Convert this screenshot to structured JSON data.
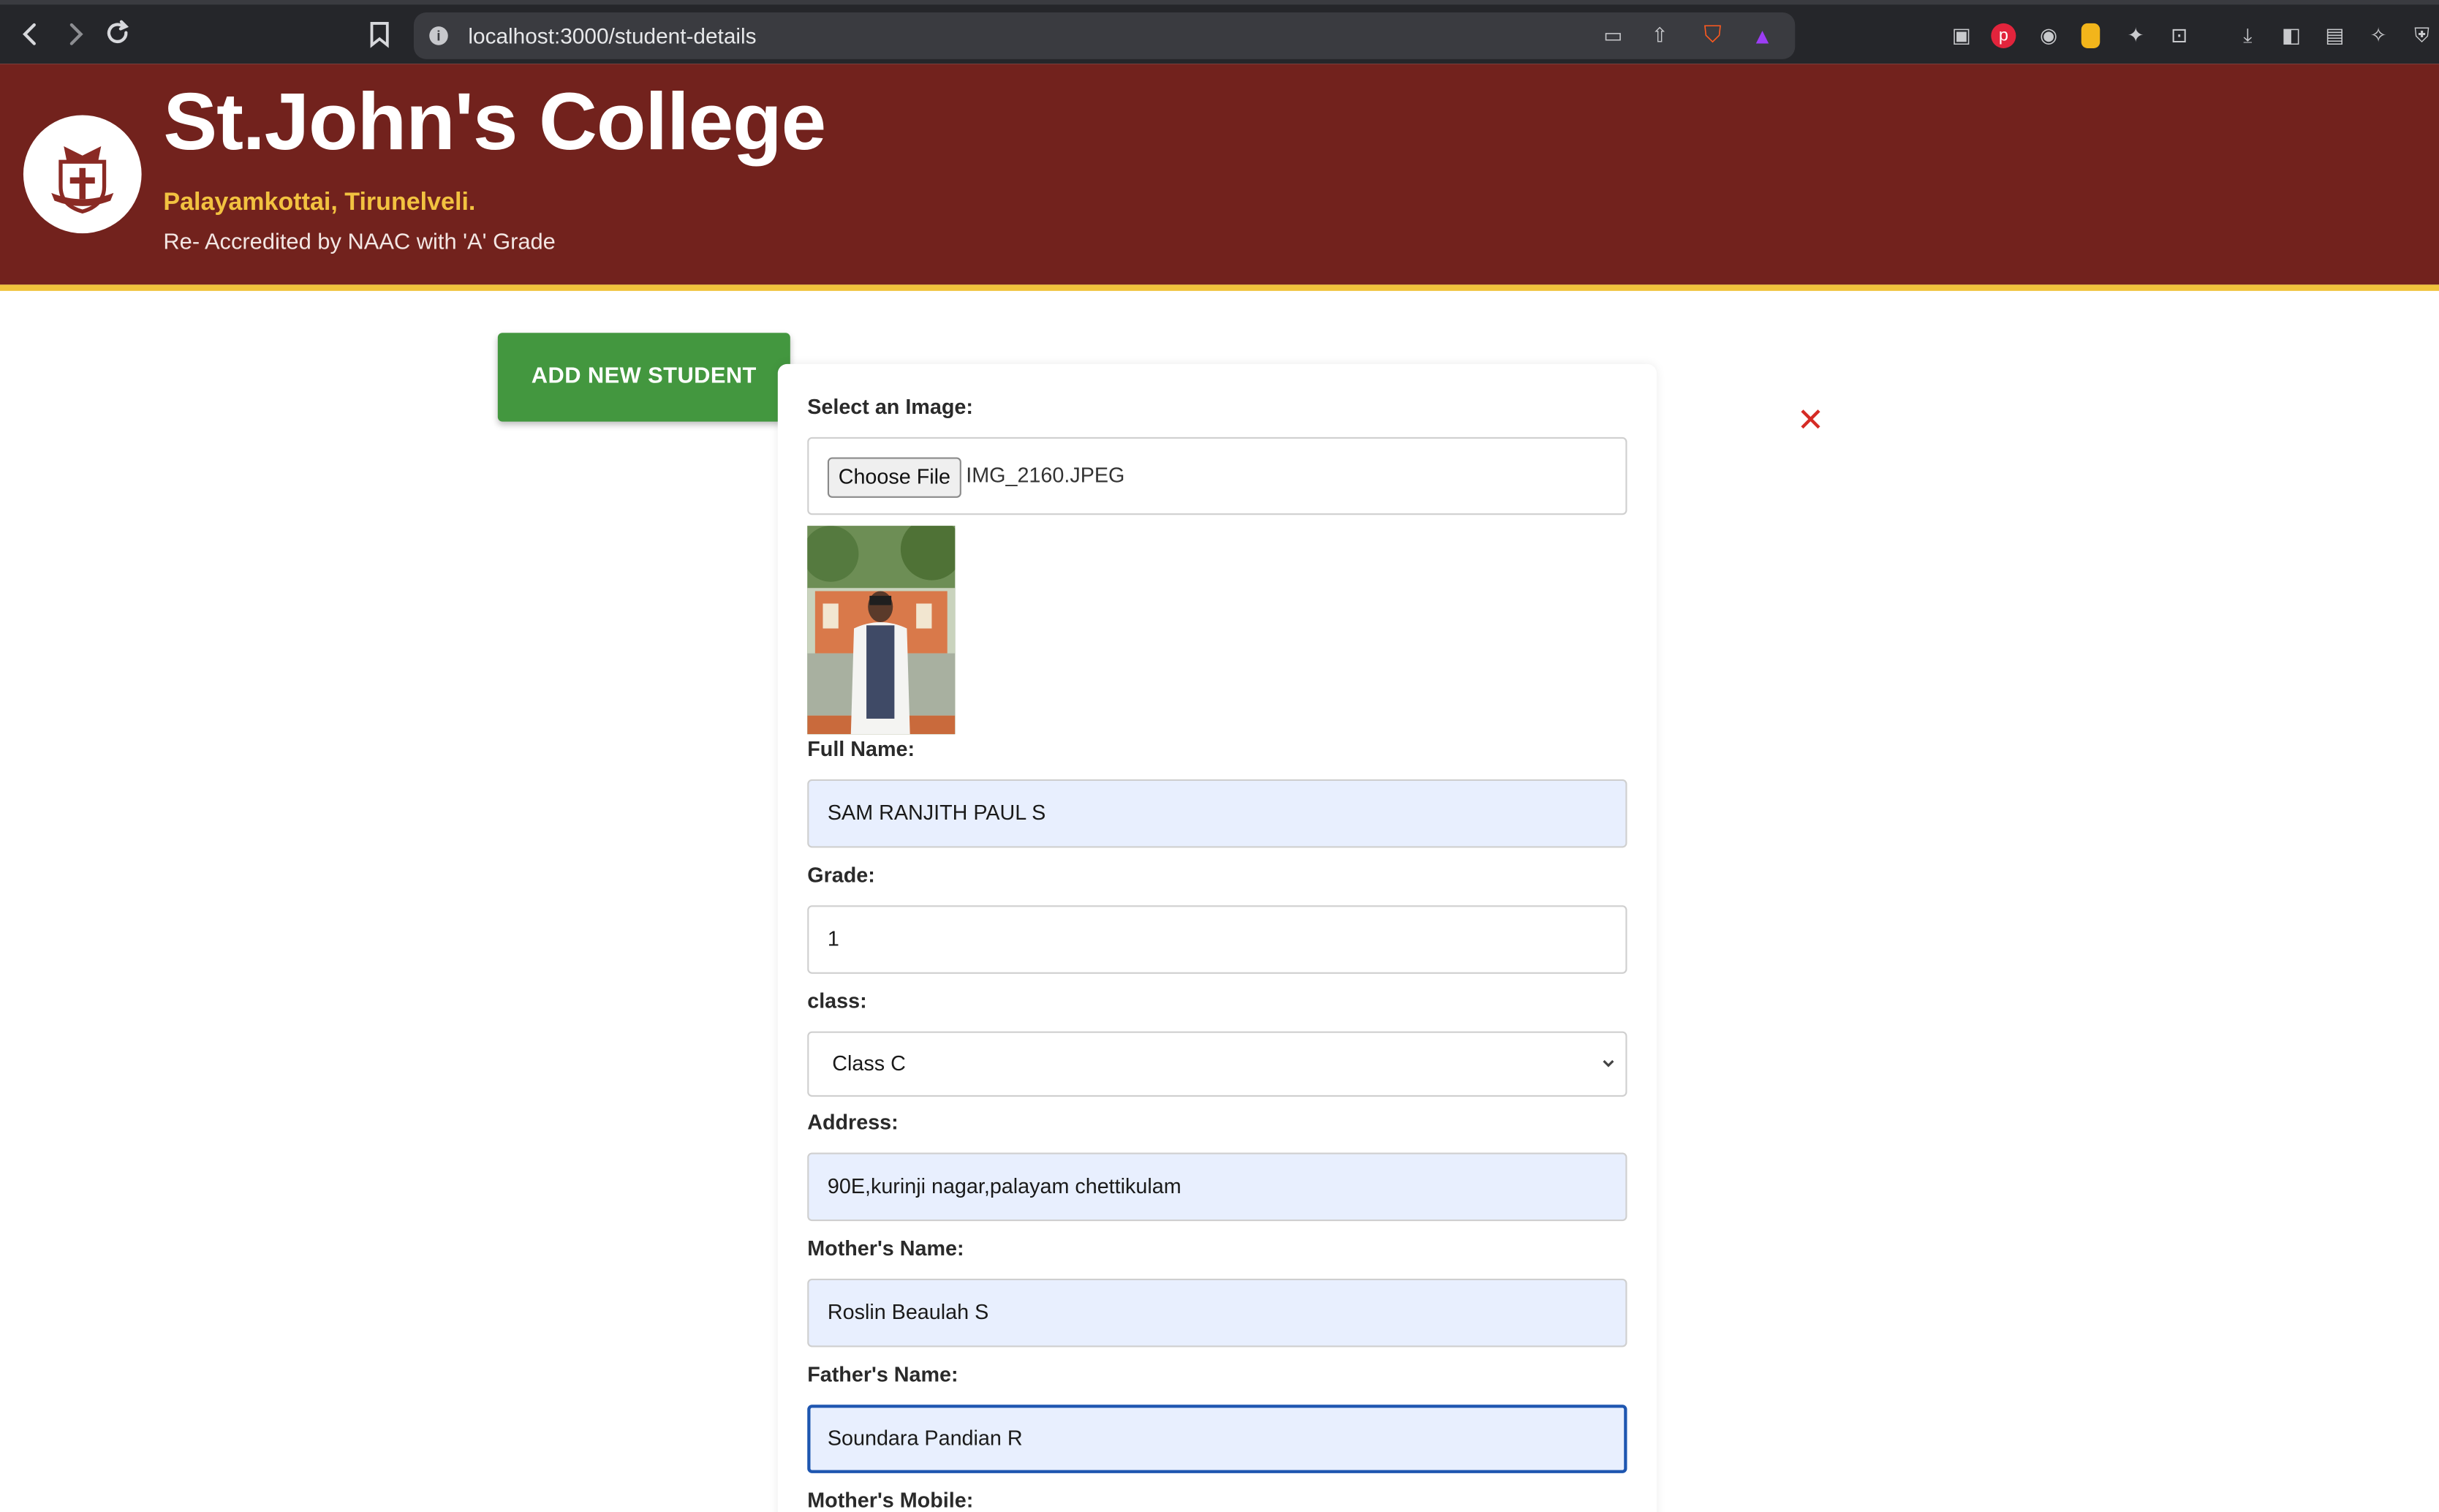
{
  "browser": {
    "url": "localhost:3000/student-details",
    "back_icon": "chevron-left-icon",
    "forward_icon": "chevron-right-icon",
    "reload_icon": "reload-icon"
  },
  "header": {
    "college_name": "St.John's College",
    "location": "Palayamkottai, Tirunelveli.",
    "accreditation": "Re- Accredited by NAAC with 'A' Grade",
    "background_color": "#72221d",
    "stripe_color": "#f0c33c"
  },
  "toolbar": {
    "add_student_label": "ADD NEW STUDENT"
  },
  "form": {
    "image_label": "Select an Image:",
    "choose_file_label": "Choose File",
    "file_name": "IMG_2160.JPEG",
    "full_name_label": "Full Name:",
    "full_name_value": "SAM RANJITH PAUL S",
    "grade_label": "Grade:",
    "grade_value": "1",
    "class_label": "class:",
    "class_value": "Class C",
    "address_label": "Address:",
    "address_value": "90E,kurinji nagar,palayam chettikulam",
    "mother_name_label": "Mother's Name:",
    "mother_name_value": "Roslin Beaulah S",
    "father_name_label": "Father's Name:",
    "father_name_value": "Soundara Pandian R",
    "mother_mobile_label": "Mother's Mobile:"
  }
}
